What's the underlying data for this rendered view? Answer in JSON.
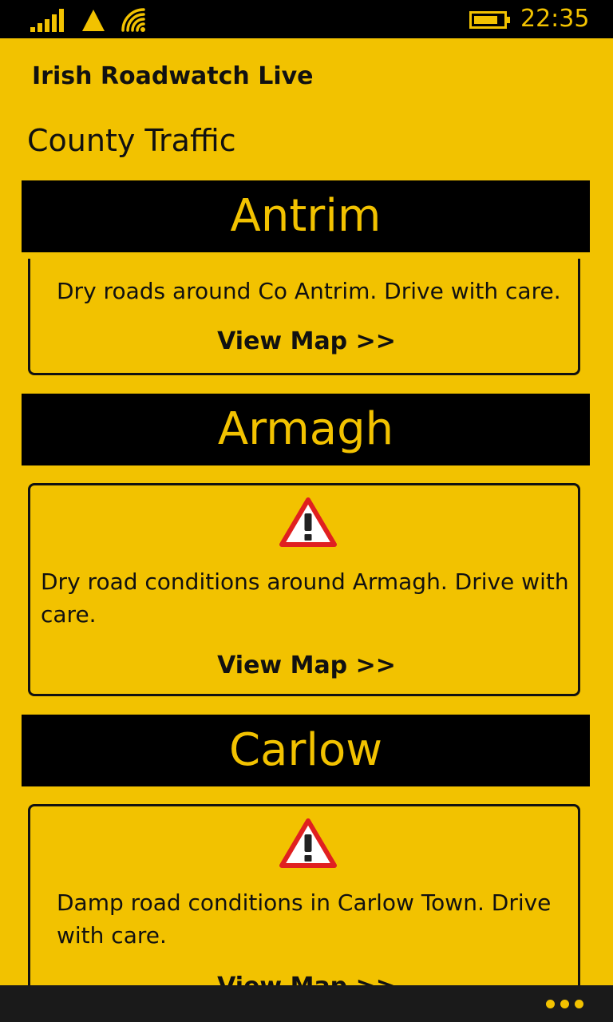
{
  "status": {
    "time": "22:35"
  },
  "app": {
    "title": "Irish Roadwatch Live"
  },
  "page": {
    "title": "County Traffic"
  },
  "counties": [
    {
      "name": "Antrim",
      "description": "Dry roads around Co Antrim. Drive with care.",
      "link": "View Map >>",
      "warning": false
    },
    {
      "name": "Armagh",
      "description_lines": [
        "Dry road conditions around Armagh. Drive with",
        "care."
      ],
      "link": "View Map >>",
      "warning": true
    },
    {
      "name": "Carlow",
      "description_lines": [
        "Damp road conditions in Carlow Town. Drive",
        "with care."
      ],
      "link": "View Map >>",
      "warning": true
    }
  ],
  "colors": {
    "accent": "#F2C200",
    "header_bg": "#000000",
    "warning_red": "#E02020"
  },
  "icons": [
    "signal-icon",
    "alert-icon",
    "wifi-icon",
    "battery-icon",
    "warning-icon",
    "more-icon"
  ]
}
